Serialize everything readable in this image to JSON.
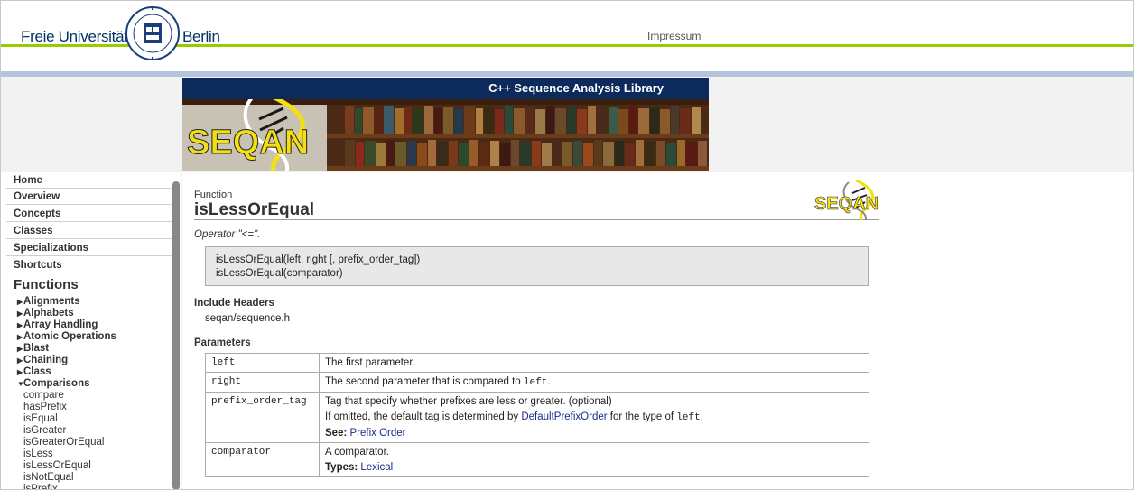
{
  "header": {
    "uni_left": "Freie Universität",
    "uni_right": "Berlin",
    "impressum": "Impressum",
    "seal_text": "VERITAS JUSTITIA LIBERTAS · FREIE UNIVERSITÄT BERLIN"
  },
  "banner": {
    "title": "C++ Sequence Analysis Library",
    "logo_text": "SEQAN"
  },
  "sidebar": {
    "nav": [
      "Home",
      "Overview",
      "Concepts",
      "Classes",
      "Specializations",
      "Shortcuts"
    ],
    "functions_heading": "Functions",
    "categories": [
      "Alignments",
      "Alphabets",
      "Array Handling",
      "Atomic Operations",
      "Blast",
      "Chaining",
      "Class"
    ],
    "open_category": "Comparisons",
    "functions": [
      "compare",
      "hasPrefix",
      "isEqual",
      "isGreater",
      "isGreaterOrEqual",
      "isLess",
      "isLessOrEqual",
      "isNotEqual",
      "isPrefix"
    ]
  },
  "content": {
    "kind": "Function",
    "title": "isLessOrEqual",
    "logo_text": "SEQAN",
    "summary": "Operator \"<=\".",
    "signatures": [
      "isLessOrEqual(left, right [, prefix_order_tag])",
      "isLessOrEqual(comparator)"
    ],
    "include_heading": "Include Headers",
    "include_file": "seqan/sequence.h",
    "params_heading": "Parameters",
    "params": {
      "p1_name": "left",
      "p1_desc": "The first parameter.",
      "p2_name": "right",
      "p2_desc": "The second parameter that is compared to ",
      "p2_code": "left",
      "p2_end": ".",
      "p3_name": "prefix_order_tag",
      "p3_desc": "Tag that specify whether prefixes are less or greater. (optional)",
      "p3_line2_a": "If omitted, the default tag is determined by ",
      "p3_link": "DefaultPrefixOrder",
      "p3_line2_b": " for the type of ",
      "p3_code": "left",
      "p3_end": ".",
      "p3_see_label": "See:",
      "p3_see_link": "Prefix Order",
      "p4_name": "comparator",
      "p4_desc": "A comparator.",
      "p4_types_label": "Types:",
      "p4_types_link": "Lexical"
    }
  },
  "colors": {
    "fu_blue": "#003366",
    "fu_green": "#99cc00",
    "banner_navy": "#0d2a5c",
    "link": "#1a2a8c",
    "logo_yellow": "#f3df12"
  }
}
